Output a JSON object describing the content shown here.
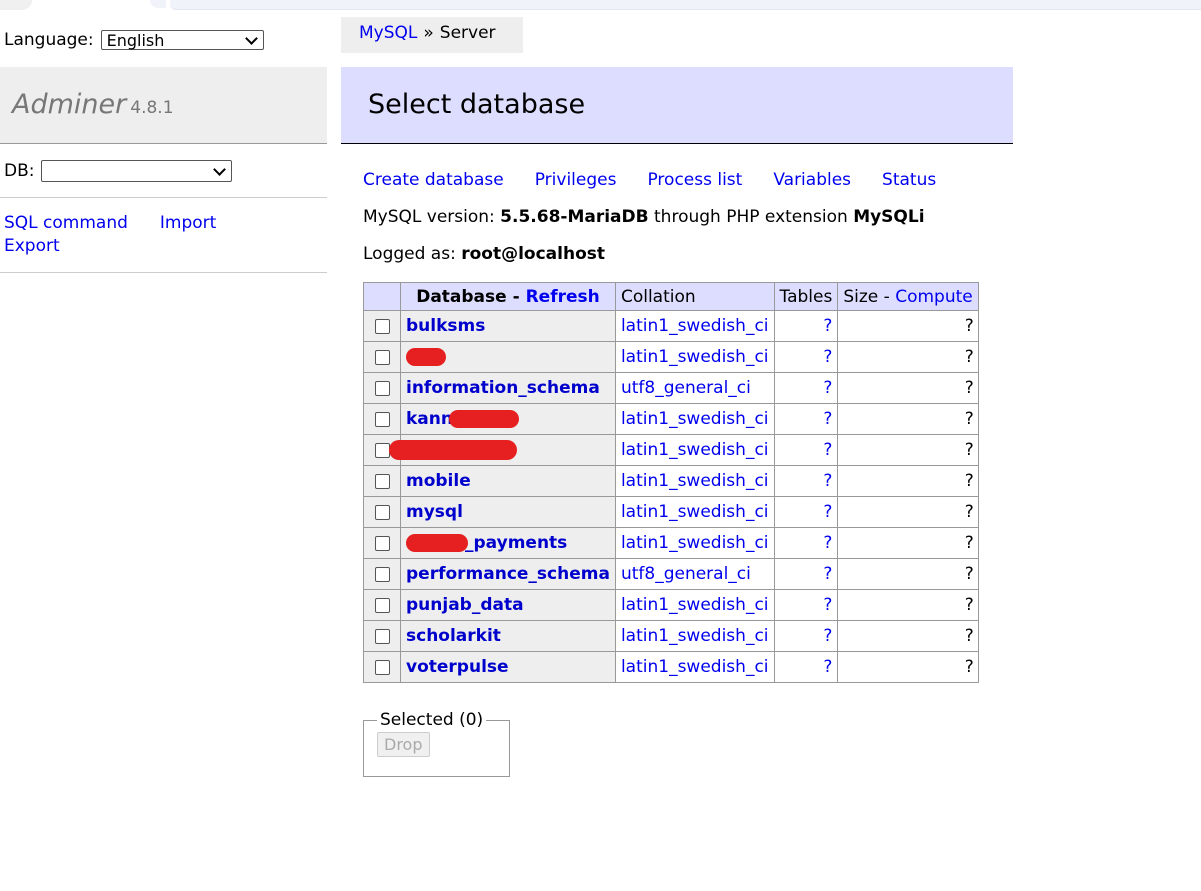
{
  "language": {
    "label": "Language:",
    "selected": "English"
  },
  "brand": {
    "name": "Adminer",
    "version": "4.8.1"
  },
  "db_select": {
    "label": "DB:",
    "selected": ""
  },
  "left_links": {
    "sql_command": "SQL command",
    "import": "Import",
    "export": "Export"
  },
  "breadcrumb": {
    "first": "MySQL",
    "separator": "»",
    "current": "Server"
  },
  "page_title": "Select database",
  "actions": [
    "Create database",
    "Privileges",
    "Process list",
    "Variables",
    "Status"
  ],
  "version_line": {
    "prefix": "MySQL version: ",
    "version": "5.5.68-MariaDB",
    "middle": " through PHP extension ",
    "extension": "MySQLi"
  },
  "logged_line": {
    "prefix": "Logged as: ",
    "user": "root@localhost"
  },
  "table": {
    "headers": {
      "database": "Database",
      "dash": " - ",
      "refresh": "Refresh",
      "collation": "Collation",
      "tables": "Tables",
      "size": "Size",
      "compute": "Compute"
    },
    "rows": [
      {
        "name": "bulksms",
        "collation": "latin1_swedish_ci",
        "tables": "?",
        "size": "?"
      },
      {
        "name": "",
        "collation": "latin1_swedish_ci",
        "tables": "?",
        "size": "?"
      },
      {
        "name": "information_schema",
        "collation": "utf8_general_ci",
        "tables": "?",
        "size": "?"
      },
      {
        "name": "kann",
        "collation": "latin1_swedish_ci",
        "tables": "?",
        "size": "?"
      },
      {
        "name": "",
        "collation": "latin1_swedish_ci",
        "tables": "?",
        "size": "?"
      },
      {
        "name": "mobile",
        "collation": "latin1_swedish_ci",
        "tables": "?",
        "size": "?"
      },
      {
        "name": "mysql",
        "collation": "latin1_swedish_ci",
        "tables": "?",
        "size": "?"
      },
      {
        "name": "_payments",
        "collation": "latin1_swedish_ci",
        "tables": "?",
        "size": "?"
      },
      {
        "name": "performance_schema",
        "collation": "utf8_general_ci",
        "tables": "?",
        "size": "?"
      },
      {
        "name": "punjab_data",
        "collation": "latin1_swedish_ci",
        "tables": "?",
        "size": "?"
      },
      {
        "name": "scholarkit",
        "collation": "latin1_swedish_ci",
        "tables": "?",
        "size": "?"
      },
      {
        "name": "voterpulse",
        "collation": "latin1_swedish_ci",
        "tables": "?",
        "size": "?"
      }
    ]
  },
  "selected": {
    "legend": "Selected (0)",
    "drop": "Drop"
  },
  "colors": {
    "link": "#0000ee",
    "header_bg": "#ddddff",
    "panel_bg": "#eeeeee",
    "redaction": "#e62020"
  }
}
